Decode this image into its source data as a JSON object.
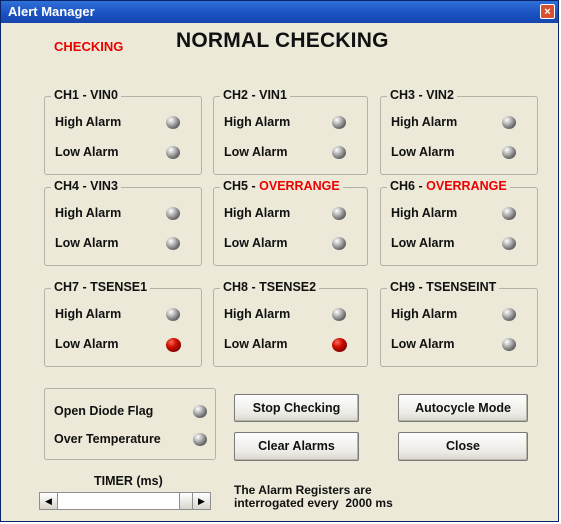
{
  "window": {
    "title": "Alert Manager",
    "close_glyph": "×"
  },
  "status": {
    "label": "CHECKING",
    "title": "NORMAL CHECKING",
    "label_color": "#e00000"
  },
  "alarm_labels": {
    "high": "High Alarm",
    "low": "Low Alarm"
  },
  "channels": [
    {
      "name": "CH1 - VIN0",
      "suffix": "",
      "high": "off",
      "low": "off"
    },
    {
      "name": "CH2 - VIN1",
      "suffix": "",
      "high": "off",
      "low": "off"
    },
    {
      "name": "CH3 - VIN2",
      "suffix": "",
      "high": "off",
      "low": "off"
    },
    {
      "name": "CH4 - VIN3",
      "suffix": "",
      "high": "off",
      "low": "off"
    },
    {
      "name": "CH5 -",
      "suffix": "OVERRANGE",
      "high": "off",
      "low": "off"
    },
    {
      "name": "CH6 -",
      "suffix": "OVERRANGE",
      "high": "off",
      "low": "off"
    },
    {
      "name": "CH7 - TSENSE1",
      "suffix": "",
      "high": "off",
      "low": "on"
    },
    {
      "name": "CH8 - TSENSE2",
      "suffix": "",
      "high": "off",
      "low": "on"
    },
    {
      "name": "CH9 - TSENSEINT",
      "suffix": "",
      "high": "off",
      "low": "off"
    }
  ],
  "flags": {
    "open_diode": "Open Diode Flag",
    "over_temperature": "Over Temperature"
  },
  "buttons": {
    "stop_checking": "Stop Checking",
    "autocycle_mode": "Autocycle Mode",
    "clear_alarms": "Clear Alarms",
    "close": "Close"
  },
  "timer": {
    "label": "TIMER (ms)",
    "slider_value_ms": 2000
  },
  "interval": {
    "line1": "The Alarm Registers are",
    "line2": "interrogated every  2000 ms"
  },
  "colors": {
    "alarm_on": "#d01000",
    "alarm_off": "#6e6e6e",
    "title_bar": "#1a50c0"
  }
}
